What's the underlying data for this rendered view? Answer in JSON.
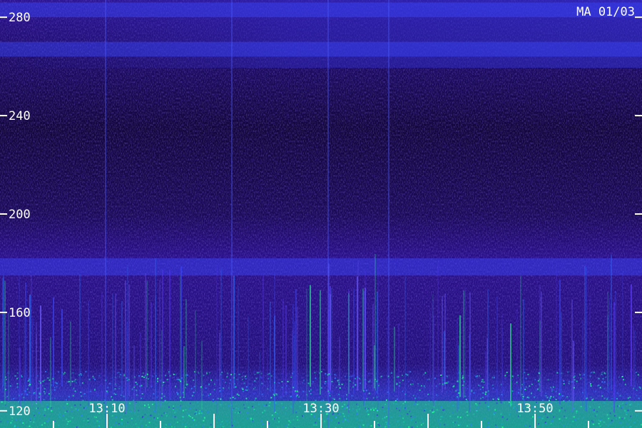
{
  "chart_data": {
    "type": "heatmap",
    "title": "MA 01/03",
    "xlabel": "",
    "ylabel": "",
    "y_ticks": [
      280,
      240,
      200,
      160,
      120
    ],
    "x_ticks": [
      "13:10",
      "13:30",
      "13:50"
    ],
    "ylim": [
      113,
      287
    ],
    "x_range": [
      "13:00",
      "14:00"
    ],
    "grid": false,
    "colors": {
      "background": "#1a0a55",
      "low": "#14063a",
      "mid": "#2a1090",
      "high": "#3a48ff",
      "peak": "#22e08a",
      "text": "#ffffff"
    },
    "bands": [
      {
        "y_from": 280,
        "y_to": 286,
        "intensity": "high"
      },
      {
        "y_from": 264,
        "y_to": 270,
        "intensity": "high"
      },
      {
        "y_from": 175,
        "y_to": 182,
        "intensity": "high"
      },
      {
        "y_from": 113,
        "y_to": 124,
        "intensity": "peak"
      }
    ]
  }
}
